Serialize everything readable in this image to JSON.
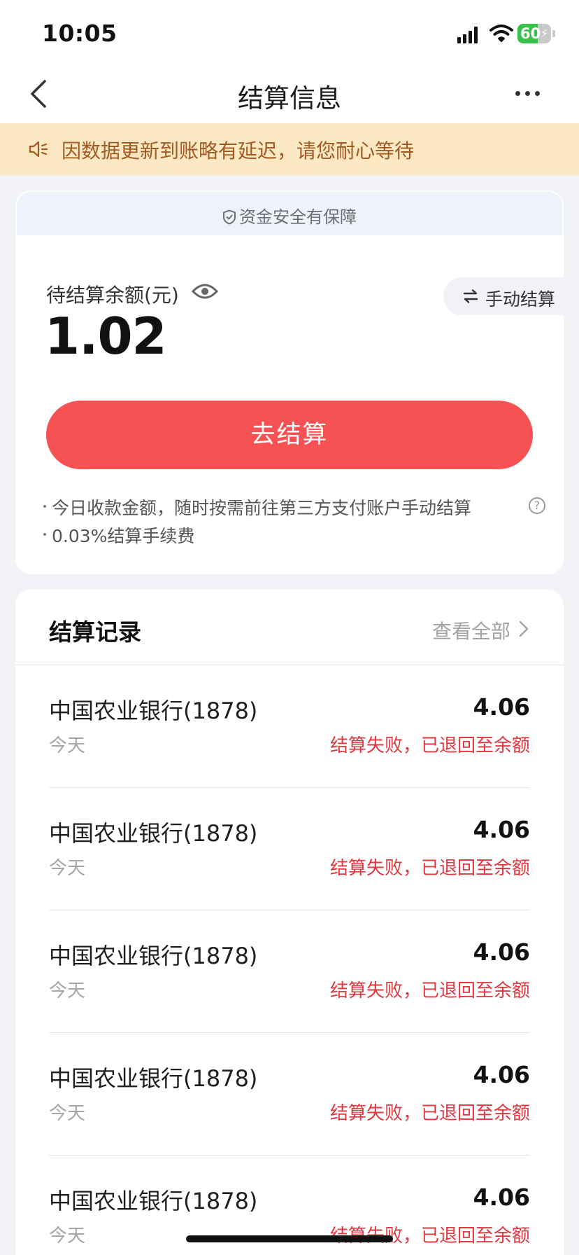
{
  "status_bar": {
    "time": "10:05",
    "battery": {
      "text": "60",
      "percent": 60
    }
  },
  "nav": {
    "title": "结算信息"
  },
  "notice": {
    "text": "因数据更新到账略有延迟，请您耐心等待"
  },
  "balance_card": {
    "security_text": "资金安全有保障",
    "label": "待结算余额(元)",
    "amount": "1.02",
    "manual_settle_label": "手动结算",
    "settle_button_label": "去结算",
    "tips": [
      "今日收款金额，随时按需前往第三方支付账户手动结算",
      "0.03%结算手续费"
    ]
  },
  "records": {
    "title": "结算记录",
    "view_all_label": "查看全部",
    "items": [
      {
        "bank": "中国农业银行(1878)",
        "date": "今天",
        "amount": "4.06",
        "status": "结算失败，已退回至余额"
      },
      {
        "bank": "中国农业银行(1878)",
        "date": "今天",
        "amount": "4.06",
        "status": "结算失败，已退回至余额"
      },
      {
        "bank": "中国农业银行(1878)",
        "date": "今天",
        "amount": "4.06",
        "status": "结算失败，已退回至余额"
      },
      {
        "bank": "中国农业银行(1878)",
        "date": "今天",
        "amount": "4.06",
        "status": "结算失败，已退回至余额"
      },
      {
        "bank": "中国农业银行(1878)",
        "date": "今天",
        "amount": "4.06",
        "status": "结算失败，已退回至余额"
      }
    ]
  },
  "colors": {
    "accent": "#f65254",
    "failure_text": "#e0383e",
    "notice_bg": "#fde8c4",
    "notice_text": "#a05a22",
    "battery_green": "#39c04b"
  },
  "icons": [
    "back-icon",
    "more-icon",
    "speaker-icon",
    "shield-icon",
    "eye-icon",
    "swap-icon",
    "help-icon",
    "chevron-right-icon"
  ]
}
